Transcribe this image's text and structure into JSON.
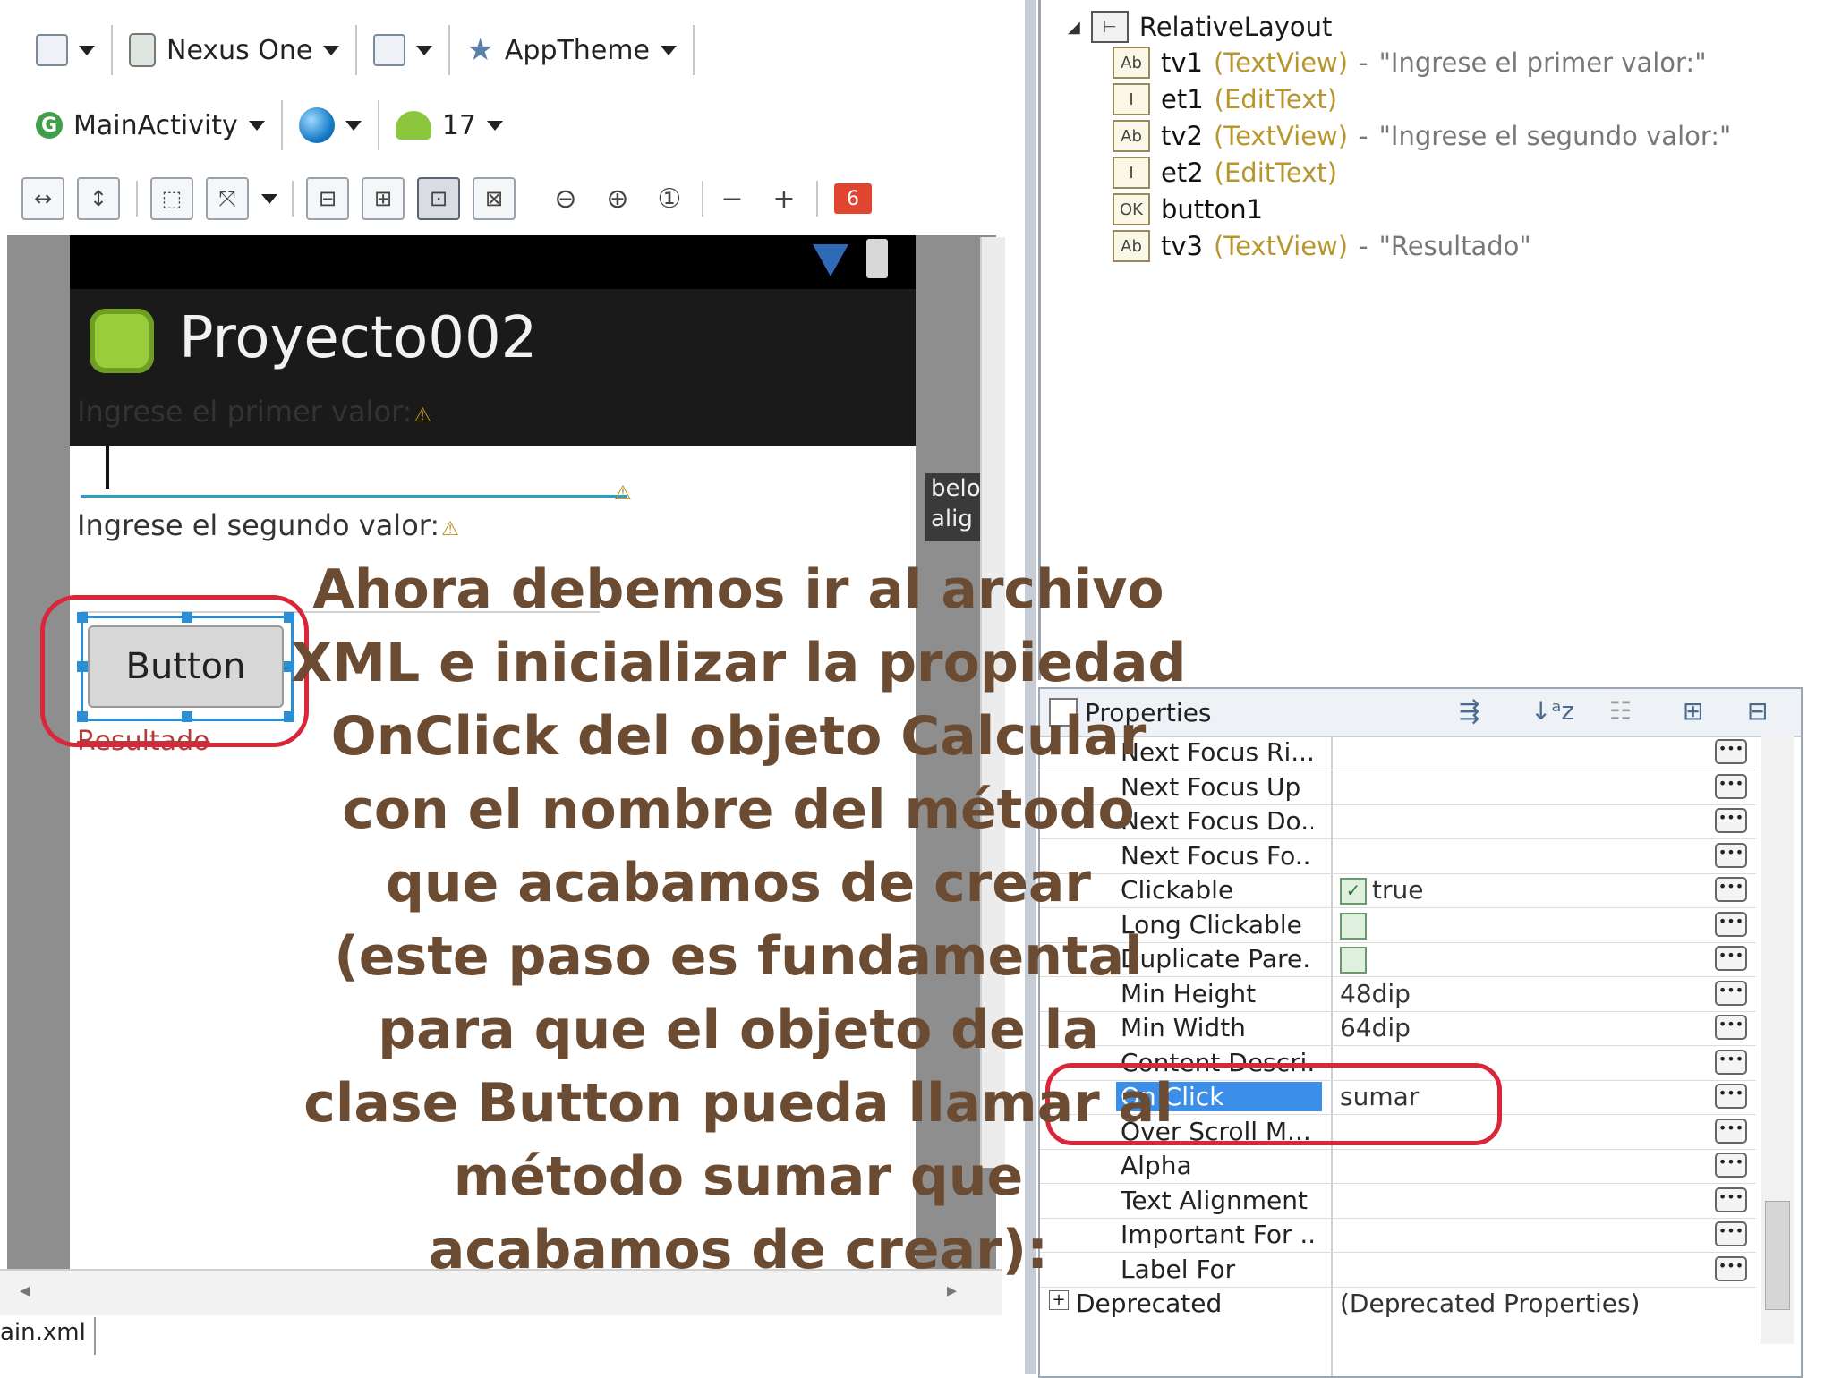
{
  "toolbar": {
    "device": "Nexus One",
    "theme": "AppTheme",
    "activity": "MainActivity",
    "api_level": "17",
    "error_count": "6"
  },
  "device_preview": {
    "app_title": "Proyecto002",
    "label1": "Ingrese el primer valor:",
    "label2": "Ingrese el segundo valor:",
    "button_text": "Button",
    "result_text": "Resultado",
    "tooltip_lines": [
      "belo",
      "alig"
    ]
  },
  "bottom_tab": "ain.xml",
  "outline": {
    "root": "RelativeLayout",
    "items": [
      {
        "id": "tv1",
        "type": "(TextView)",
        "sep": "-",
        "text": "\"Ingrese el primer valor:\"",
        "icon": "Ab"
      },
      {
        "id": "et1",
        "type": "(EditText)",
        "sep": "",
        "text": "",
        "icon": "I"
      },
      {
        "id": "tv2",
        "type": "(TextView)",
        "sep": "-",
        "text": "\"Ingrese el segundo valor:\"",
        "icon": "Ab"
      },
      {
        "id": "et2",
        "type": "(EditText)",
        "sep": "",
        "text": "",
        "icon": "I"
      },
      {
        "id": "button1",
        "type": "",
        "sep": "",
        "text": "",
        "icon": "OK"
      },
      {
        "id": "tv3",
        "type": "(TextView)",
        "sep": "-",
        "text": "\"Resultado\"",
        "icon": "Ab"
      }
    ]
  },
  "properties": {
    "title": "Properties",
    "rows": [
      {
        "name": "Next Focus Ri...",
        "value": ""
      },
      {
        "name": "Next Focus Up",
        "value": ""
      },
      {
        "name": "Next Focus Do...",
        "value": ""
      },
      {
        "name": "Next Focus Fo...",
        "value": ""
      },
      {
        "name": "Clickable",
        "value": "true"
      },
      {
        "name": "Long Clickable",
        "value": ""
      },
      {
        "name": "Duplicate Pare...",
        "value": ""
      },
      {
        "name": "Min Height",
        "value": "48dip"
      },
      {
        "name": "Min Width",
        "value": "64dip"
      },
      {
        "name": "Content Descri...",
        "value": ""
      },
      {
        "name": "On Click",
        "value": "sumar"
      },
      {
        "name": "Over Scroll M...",
        "value": ""
      },
      {
        "name": "Alpha",
        "value": ""
      },
      {
        "name": "Text Alignment",
        "value": ""
      },
      {
        "name": "Important For ...",
        "value": ""
      },
      {
        "name": "Label For",
        "value": ""
      }
    ],
    "deprecated_name": "Deprecated",
    "deprecated_value": "(Deprecated Properties)"
  },
  "overlay_text": [
    "Ahora debemos ir al archivo",
    "XML e inicializar la propiedad",
    "OnClick del objeto Calcular",
    "con el nombre del método",
    "que acabamos de crear",
    "(este paso es fundamental",
    "para que el objeto de la",
    "clase Button pueda llamar al",
    "método sumar que",
    "acabamos de crear):"
  ],
  "colors": {
    "overlay_text": "#6b4c32",
    "highlight_ring": "#d9263a",
    "selection_blue": "#3b8fe8",
    "type_label": "#b8962e"
  }
}
